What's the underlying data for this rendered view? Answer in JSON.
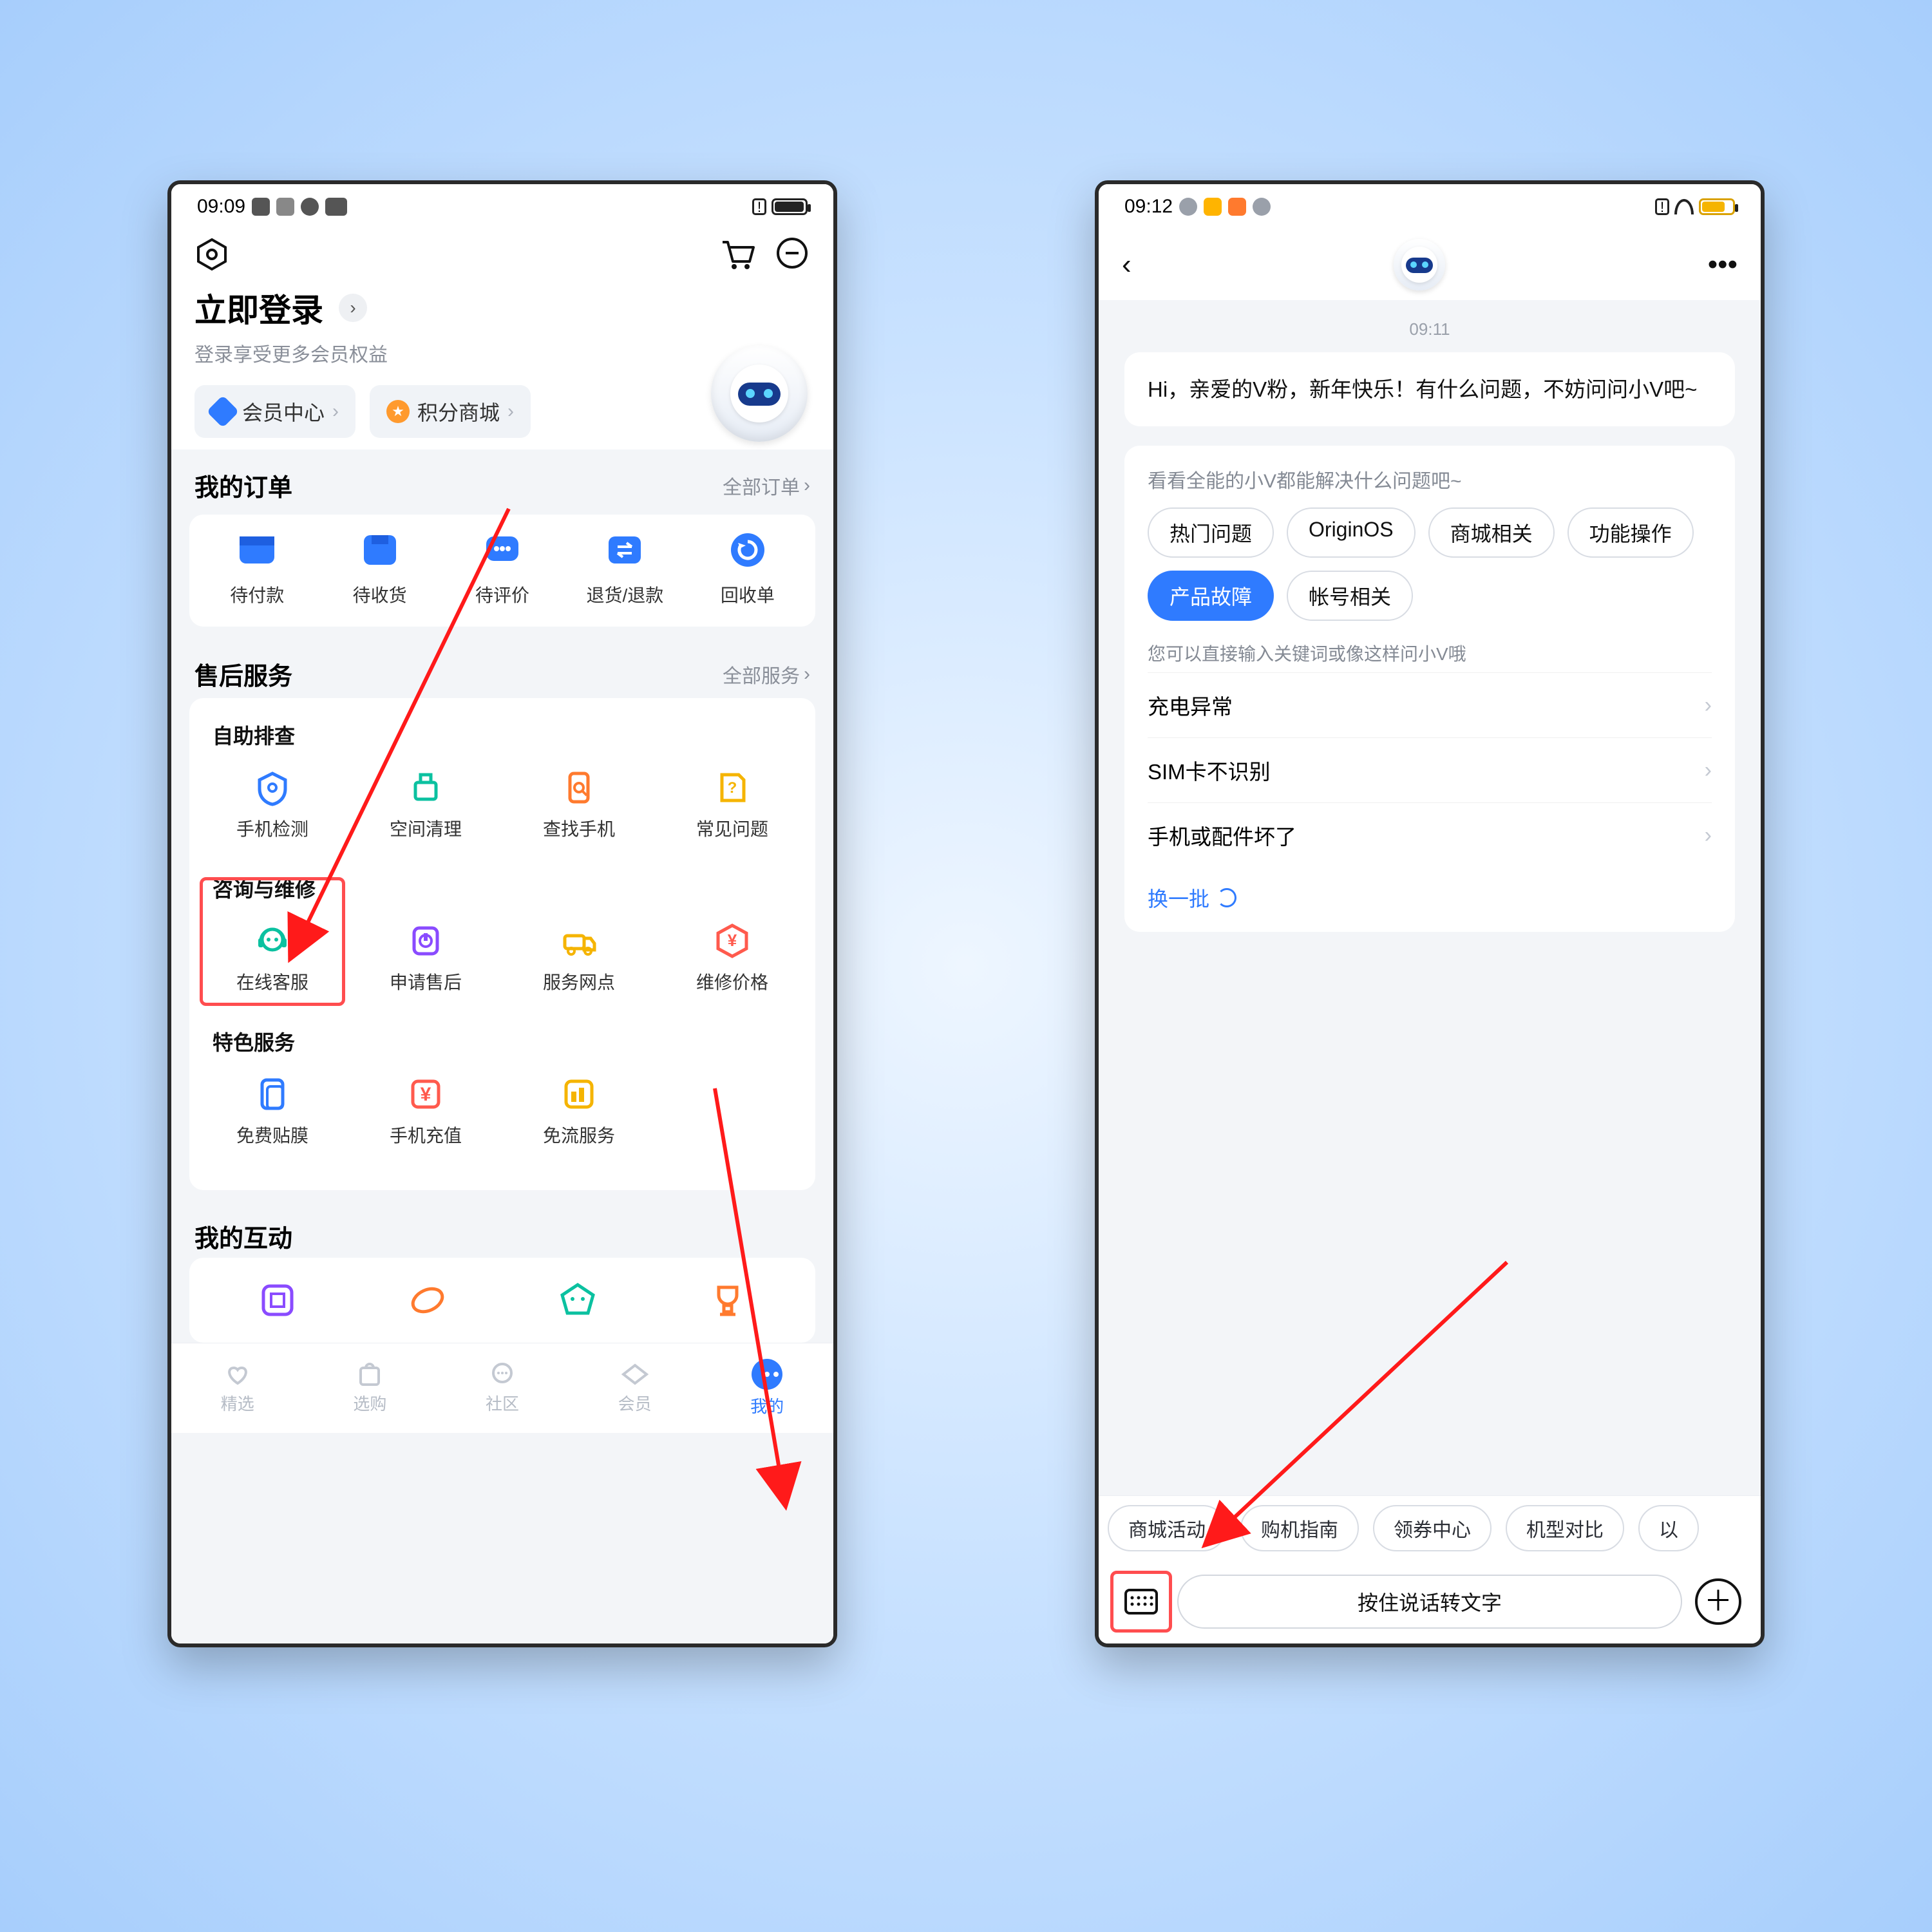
{
  "left": {
    "status": {
      "time": "09:09"
    },
    "login": {
      "title": "立即登录",
      "subtitle": "登录享受更多会员权益"
    },
    "chips": {
      "member": "会员中心",
      "points": "积分商城"
    },
    "orders": {
      "title": "我的订单",
      "more": "全部订单",
      "items": [
        "待付款",
        "待收货",
        "待评价",
        "退货/退款",
        "回收单"
      ]
    },
    "services": {
      "title": "售后服务",
      "more": "全部服务",
      "self_title": "自助排查",
      "self_items": [
        "手机检测",
        "空间清理",
        "查找手机",
        "常见问题"
      ],
      "consult_title": "咨询与维修",
      "consult_items": [
        "在线客服",
        "申请售后",
        "服务网点",
        "维修价格"
      ],
      "special_title": "特色服务",
      "special_items": [
        "免费贴膜",
        "手机充值",
        "免流服务"
      ]
    },
    "interaction": {
      "title": "我的互动"
    },
    "tabbar": [
      "精选",
      "选购",
      "社区",
      "会员",
      "我的"
    ]
  },
  "right": {
    "status": {
      "time": "09:12"
    },
    "timestamp": "09:11",
    "greeting": "Hi，亲爱的V粉，新年快乐！有什么问题，不妨问问小V吧~",
    "helper": {
      "title": "看看全能的小V都能解决什么问题吧~",
      "tags": [
        "热门问题",
        "OriginOS",
        "商城相关",
        "功能操作",
        "产品故障",
        "帐号相关"
      ],
      "tip": "您可以直接输入关键词或像这样问小V哦",
      "faqs": [
        "充电异常",
        "SIM卡不识别",
        "手机或配件坏了"
      ],
      "refresh": "换一批"
    },
    "suggestions": [
      "商城活动",
      "购机指南",
      "领券中心",
      "机型对比",
      "以"
    ],
    "input": "按住说话转文字"
  }
}
